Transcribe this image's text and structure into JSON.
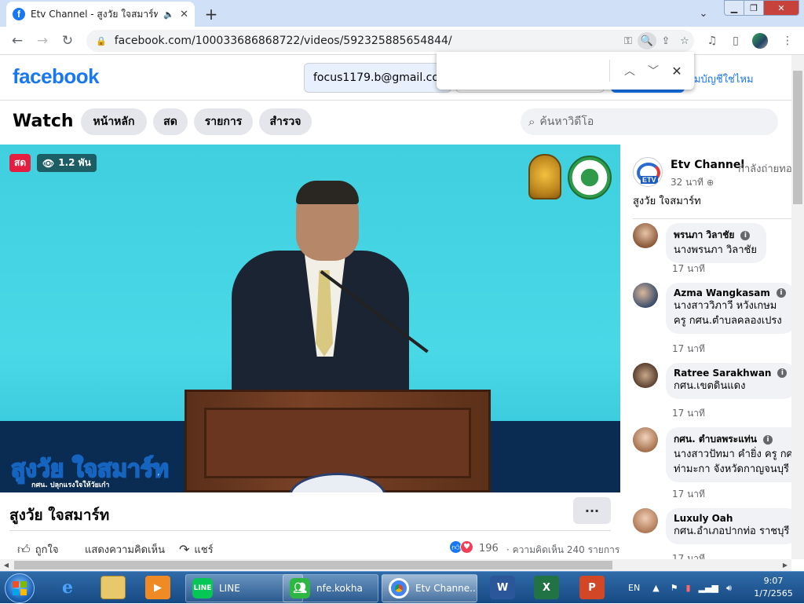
{
  "browser": {
    "tab_title": "Etv Channel - สูงวัย ใจสมาร์ท",
    "url": "facebook.com/100033686868722/videos/592325885654844/",
    "find_value": ""
  },
  "fb": {
    "logo": "facebook",
    "email_value": "focus1179.b@gmail.com",
    "forgot_label": "ลืมบัญชีใช่ไหม"
  },
  "watch": {
    "title": "Watch",
    "pills": [
      "หน้าหลัก",
      "สด",
      "รายการ",
      "สำรวจ"
    ],
    "search_placeholder": "ค้นหาวิดีโอ"
  },
  "video": {
    "live_badge": "สด",
    "viewers": "1.2 พัน",
    "overlay_title": "สูงวัย ใจสมาร์ท",
    "overlay_sub": "กศน. ปลุกแรงใจให้วัยเก๋า",
    "title": "สูงวัย ใจสมาร์ท",
    "more_label": "···",
    "like_label": "ถูกใจ",
    "comment_label": "แสดงความคิดเห็น",
    "share_label": "แชร์",
    "reaction_count": "196",
    "comment_count": "· ความคิดเห็น 240 รายการ"
  },
  "panel": {
    "channel_name": "Etv Channel",
    "channel_status": "กำลังถ่ายทอดสด",
    "channel_time": "32 นาที",
    "channel_logo_text": "ETV",
    "description": "สูงวัย ใจสมาร์ท",
    "comments": [
      {
        "name": "พรนภา วิลาชัย",
        "lines": [
          "นางพรนภา วิลาชัย"
        ],
        "time": "17 นาที"
      },
      {
        "name": "Azma Wangkasam",
        "lines": [
          "นางสาววิภาวี หวังเกษม",
          "ครู กศน.ตำบลคลองเปรง"
        ],
        "time": "17 นาที"
      },
      {
        "name": "Ratree Sarakhwan",
        "lines": [
          "กศน.เขตดินแดง"
        ],
        "time": "17 นาที"
      },
      {
        "name": "กศน. ตำบลพระแท่น",
        "lines": [
          "นางสาวปัทมา คำยิ่ง ครู กศน.",
          "ท่ามะกา จังหวัดกาญจนบุรี"
        ],
        "time": "17 นาที"
      },
      {
        "name": "Luxuly Oah",
        "lines": [
          "กศน.อำเภอปากท่อ ราชบุรี"
        ],
        "time": "17 นาที"
      }
    ]
  },
  "taskbar": {
    "apps": [
      {
        "label": "LINE",
        "icon": "LINE"
      },
      {
        "label": "nfe.kokha",
        "icon": "people"
      },
      {
        "label": "Etv Channe...",
        "icon": "chrome"
      }
    ],
    "lang": "EN",
    "time": "9:07",
    "date": "1/7/2565"
  },
  "colors": {
    "fb_blue": "#1877f2",
    "live_red": "#e41e3f",
    "taskbar": "#1e5592"
  }
}
